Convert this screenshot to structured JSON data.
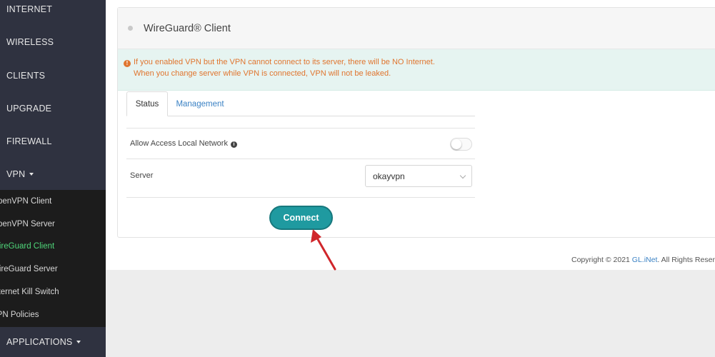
{
  "sidebar": {
    "items": [
      {
        "label": "INTERNET"
      },
      {
        "label": "WIRELESS"
      },
      {
        "label": "CLIENTS"
      },
      {
        "label": "UPGRADE"
      },
      {
        "label": "FIREWALL"
      },
      {
        "label": "VPN"
      }
    ],
    "vpn_submenu": [
      {
        "label": "OpenVPN Client"
      },
      {
        "label": "OpenVPN Server"
      },
      {
        "label": "WireGuard Client",
        "active": true
      },
      {
        "label": "WireGuard Server"
      },
      {
        "label": "Internet Kill Switch"
      },
      {
        "label": "VPN Policies"
      }
    ],
    "applications_label": "APPLICATIONS"
  },
  "card": {
    "title": "WireGuard® Client",
    "alert_line1": "If you enabled VPN but the VPN cannot connect to its server, there will be NO Internet.",
    "alert_line2": "When you change server while VPN is connected, VPN will not be leaked."
  },
  "tabs": [
    {
      "label": "Status",
      "active": true
    },
    {
      "label": "Management",
      "active": false
    }
  ],
  "form": {
    "allow_local_label": "Allow Access Local Network",
    "allow_local_enabled": false,
    "server_label": "Server",
    "server_value": "okayvpn",
    "connect_label": "Connect"
  },
  "footer": {
    "prefix": "Copyright © 2021 ",
    "brand": "GL.iNet",
    "suffix": ". All Rights Reserved"
  },
  "colors": {
    "sidebar": "#2f3240",
    "submenu": "#1c1c1c",
    "active_item": "#4fd67a",
    "alert_text": "#e0752f",
    "alert_bg": "#e6f4f1",
    "primary": "#1f9aa0",
    "annotation_arrow": "#d0262b"
  }
}
